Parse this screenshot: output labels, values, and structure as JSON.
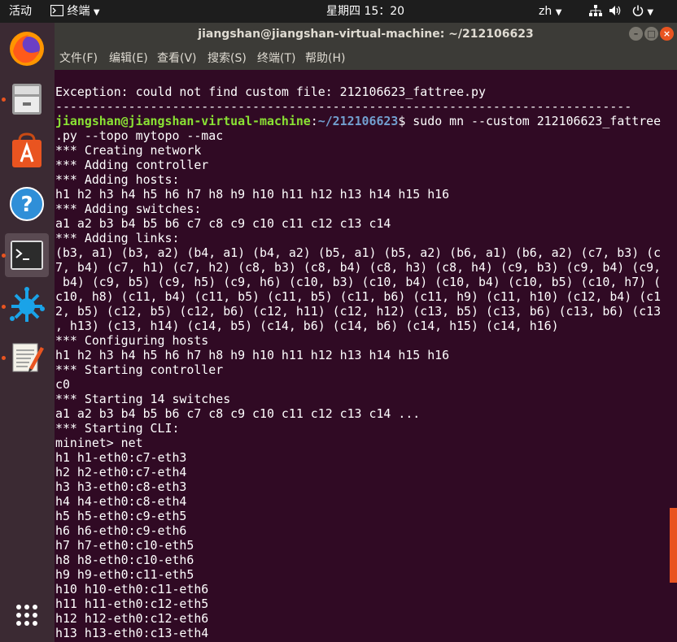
{
  "topbar": {
    "activities": "活动",
    "app_menu": "终端",
    "clock": "星期四 15：20",
    "input_method": "zh"
  },
  "window": {
    "title": "jiangshan@jiangshan-virtual-machine: ~/212106623"
  },
  "menu": {
    "file": "文件(F)",
    "edit": "编辑(E)",
    "view": "查看(V)",
    "search": "搜索(S)",
    "terminal": "终端(T)",
    "help": "帮助(H)"
  },
  "dock": {
    "items": [
      "firefox-icon",
      "files-icon",
      "software-center-icon",
      "help-icon",
      "terminal-icon",
      "app-icon",
      "text-editor-icon"
    ],
    "show_apps": "show-apps-icon"
  },
  "terminal": {
    "error_line": "Exception: could not find custom file: 212106623_fattree.py",
    "separator": "-------------------------------------------------------------------------------",
    "prompt_user": "jiangshan@jiangshan-virtual-machine",
    "prompt_sep": ":",
    "prompt_path": "~/212106623",
    "prompt_dollar": "$",
    "command": " sudo mn --custom 212106623_fattree\n.py --topo mytopo --mac",
    "output": "*** Creating network\n*** Adding controller\n*** Adding hosts:\nh1 h2 h3 h4 h5 h6 h7 h8 h9 h10 h11 h12 h13 h14 h15 h16\n*** Adding switches:\na1 a2 b3 b4 b5 b6 c7 c8 c9 c10 c11 c12 c13 c14\n*** Adding links:\n(b3, a1) (b3, a2) (b4, a1) (b4, a2) (b5, a1) (b5, a2) (b6, a1) (b6, a2) (c7, b3) (c\n7, b4) (c7, h1) (c7, h2) (c8, b3) (c8, b4) (c8, h3) (c8, h4) (c9, b3) (c9, b4) (c9,\n b4) (c9, b5) (c9, h5) (c9, h6) (c10, b3) (c10, b4) (c10, b4) (c10, b5) (c10, h7) (\nc10, h8) (c11, b4) (c11, b5) (c11, b5) (c11, b6) (c11, h9) (c11, h10) (c12, b4) (c1\n2, b5) (c12, b5) (c12, b6) (c12, h11) (c12, h12) (c13, b5) (c13, b6) (c13, b6) (c13\n, h13) (c13, h14) (c14, b5) (c14, b6) (c14, b6) (c14, h15) (c14, h16)\n*** Configuring hosts\nh1 h2 h3 h4 h5 h6 h7 h8 h9 h10 h11 h12 h13 h14 h15 h16\n*** Starting controller\nc0\n*** Starting 14 switches\na1 a2 b3 b4 b5 b6 c7 c8 c9 c10 c11 c12 c13 c14 ...\n*** Starting CLI:\nmininet> net\nh1 h1-eth0:c7-eth3\nh2 h2-eth0:c7-eth4\nh3 h3-eth0:c8-eth3\nh4 h4-eth0:c8-eth4\nh5 h5-eth0:c9-eth5\nh6 h6-eth0:c9-eth6\nh7 h7-eth0:c10-eth5\nh8 h8-eth0:c10-eth6\nh9 h9-eth0:c11-eth5\nh10 h10-eth0:c11-eth6\nh11 h11-eth0:c12-eth5\nh12 h12-eth0:c12-eth6\nh13 h13-eth0:c13-eth4"
  },
  "scrollbar": {
    "position_fraction": 0.88,
    "visible_fraction": 0.13,
    "thumb_color": "#e95420"
  },
  "colors": {
    "terminal_bg": "#300a24",
    "prompt_user": "#8ae234",
    "prompt_path": "#729fcf",
    "accent": "#e95420"
  }
}
